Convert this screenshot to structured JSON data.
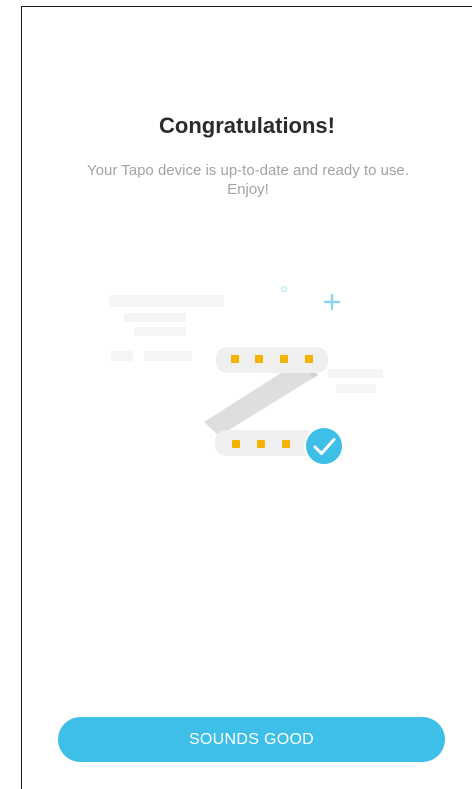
{
  "screen": {
    "title": "Congratulations!",
    "message": "Your Tapo device is up-to-date and ready to use. Enjoy!"
  },
  "illustration": {
    "icon_names": [
      "light-strip-icon",
      "checkmark-badge-icon",
      "sparkle-plus-icon"
    ],
    "colors": {
      "strip_body": "#eeeeee",
      "strip_fold": "#dddddd",
      "led": "#f5b301",
      "check_badge": "#3ebfe8",
      "sparkle": "#8fd3f0",
      "background_shapes": "#f6f6f6"
    }
  },
  "actions": {
    "confirm_label": "SOUNDS GOOD"
  },
  "colors": {
    "accent": "#3ebfe8",
    "title_text": "#2b2b2b",
    "body_text": "#a3a3a3"
  }
}
